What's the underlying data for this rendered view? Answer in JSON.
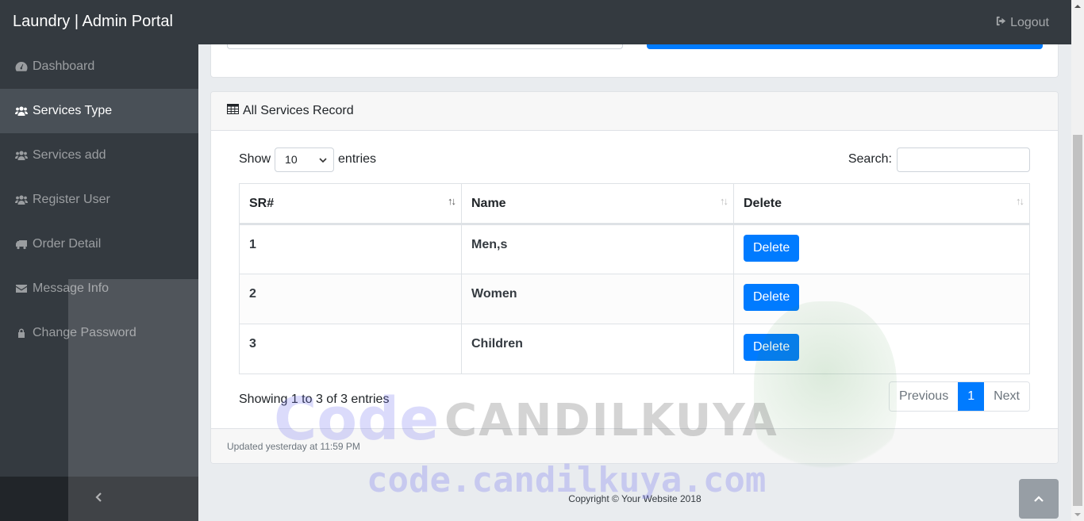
{
  "header": {
    "brand": "Laundry | Admin Portal",
    "logout_label": "Logout",
    "logout_icon": "sign-out-icon"
  },
  "sidebar": {
    "items": [
      {
        "label": "Dashboard",
        "icon": "tachometer-icon",
        "active": false
      },
      {
        "label": "Services Type",
        "icon": "users-icon",
        "active": true
      },
      {
        "label": "Services add",
        "icon": "users-icon",
        "active": false
      },
      {
        "label": "Register User",
        "icon": "users-icon",
        "active": false
      },
      {
        "label": "Order Detail",
        "icon": "truck-icon",
        "active": false
      },
      {
        "label": "Message Info",
        "icon": "envelope-icon",
        "active": false
      },
      {
        "label": "Change Password",
        "icon": "lock-icon",
        "active": false
      }
    ],
    "toggle_icon": "chevron-left-icon"
  },
  "records_card": {
    "title": "All Services Record",
    "title_icon": "table-icon",
    "length_prefix": "Show",
    "length_value": "10",
    "length_suffix": "entries",
    "search_label": "Search:",
    "search_value": "",
    "columns": [
      "SR#",
      "Name",
      "Delete"
    ],
    "rows": [
      {
        "sr": "1",
        "name": "Men,s",
        "action": "Delete"
      },
      {
        "sr": "2",
        "name": "Women",
        "action": "Delete"
      },
      {
        "sr": "3",
        "name": "Children",
        "action": "Delete"
      }
    ],
    "info": "Showing 1 to 3 of 3 entries",
    "pagination": {
      "previous": "Previous",
      "current": "1",
      "next": "Next"
    },
    "footer": "Updated yesterday at 11:59 PM"
  },
  "page_footer": "Copyright © Your Website 2018",
  "watermark": {
    "line1_a": "Code",
    "line1_b": "CANDILKUYA",
    "line2": "code.candilkuya.com"
  },
  "colors": {
    "primary": "#007bff",
    "sidebar_bg": "#343a40",
    "active_item_bg": "#495057"
  }
}
